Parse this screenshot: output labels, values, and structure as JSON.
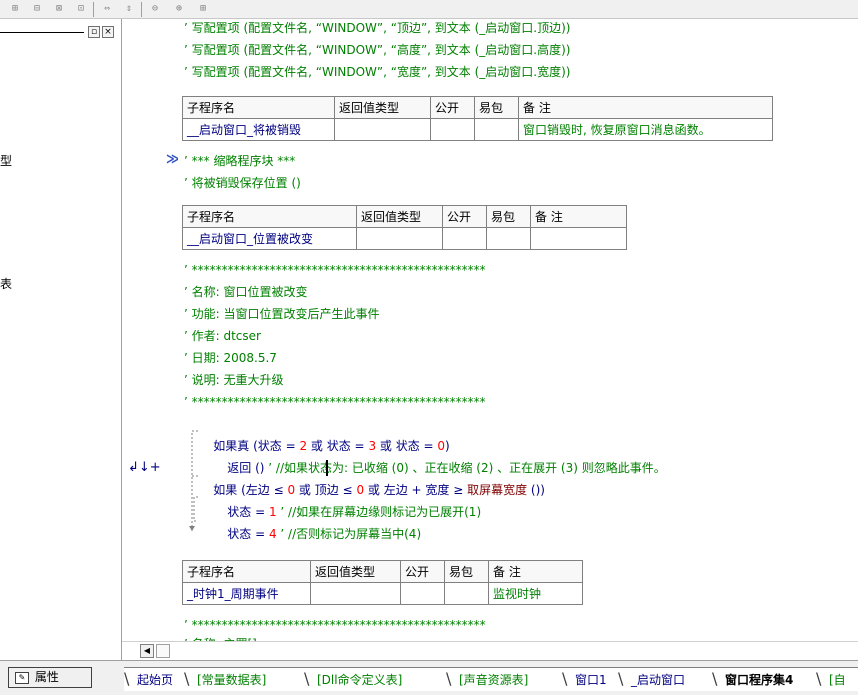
{
  "toolbar": {
    "icons": [
      "grid-icon",
      "align-top-icon",
      "align-middle-icon",
      "align-bottom-icon",
      "width-equal-icon",
      "height-equal-icon",
      "hspace-icon",
      "vspace-icon",
      "center-icon"
    ]
  },
  "left_panel": {
    "title_line": "",
    "frag1": "型",
    "frag2": "表",
    "close_x": "×"
  },
  "gutter": {
    "marker": "≫",
    "arrows": "↲↓+"
  },
  "lines": {
    "l1": "’ 写配置项 (配置文件名, “WINDOW”, “顶边”, 到文本 (_启动窗口.顶边))",
    "l2": "’ 写配置项 (配置文件名, “WINDOW”, “高度”, 到文本 (_启动窗口.高度))",
    "l3": "’ 写配置项 (配置文件名, “WINDOW”, “宽度”, 到文本 (_启动窗口.宽度))",
    "l4": "’ *** 缩略程序块 ***",
    "l5": "’ 将被销毁保存位置 ()",
    "l6": "’ *************************************************",
    "l7": "’ 名称: 窗口位置被改变",
    "l8": "’ 功能: 当窗口位置改变后产生此事件",
    "l9": "’ 作者: dtcser",
    "l10": "’ 日期: 2008.5.7",
    "l11": "’ 说明: 无重大升级",
    "l12": "’ *************************************************",
    "l20": "’ *************************************************",
    "l21": "’ 名称: 主罪[]"
  },
  "code": {
    "if_true": "如果真",
    "state": "状态",
    "cond1": " (状态 = ",
    "n2": "2",
    "or1": " 或 状态 = ",
    "n3": "3",
    "or2": " 或 状态 = ",
    "n0": "0",
    "close": ")",
    "ret": "返回",
    "ret_rest": " () ",
    "ret_cm": "’ //如果状态为: 已收缩 (0) 、正在收缩 (2) 、正在展开 (3) 则忽略此事件。",
    "if": "如果",
    "if_cond_a": " (左边",
    "if_cond_b": " ≤ ",
    "if_n0a": "0",
    "if_cond_c": " 或 顶边 ≤ ",
    "if_n0b": "0",
    "if_cond_d": " 或 左边 + 宽度 ≥ ",
    "if_fn": "取屏幕宽度",
    "if_cond_e": " ())",
    "assign1_a": "状态 = ",
    "assign1_n": "1",
    "assign1_cm": " ’ //如果在屏幕边缘则标记为已展开(1)",
    "assign2_a": "状态 = ",
    "assign2_n": "4",
    "assign2_cm": " ’ //否则标记为屏幕当中(4)"
  },
  "tables": {
    "t1": {
      "headers": [
        "子程序名",
        "返回值类型",
        "公开",
        "易包",
        "备 注"
      ],
      "row": [
        "__启动窗口_将被销毁",
        "",
        "",
        "",
        "窗口销毁时, 恢复原窗口消息函数。"
      ]
    },
    "t2": {
      "headers": [
        "子程序名",
        "返回值类型",
        "公开",
        "易包",
        "备 注"
      ],
      "row": [
        "__启动窗口_位置被改变",
        "",
        "",
        "",
        ""
      ]
    },
    "t3": {
      "headers": [
        "子程序名",
        "返回值类型",
        "公开",
        "易包",
        "备 注"
      ],
      "row": [
        "_时钟1_周期事件",
        "",
        "",
        "",
        "监视时钟"
      ]
    }
  },
  "statusbar": {
    "prop_label": "属性",
    "prop_icon": "properties-icon"
  },
  "tabs": [
    "起始页",
    "[常量数据表]",
    "[Dll命令定义表]",
    "[声音资源表]",
    "窗口1",
    "_启动窗口",
    "窗口程序集4",
    "[自"
  ],
  "colors": {
    "comment": "#008000",
    "keyword": "#000080",
    "number": "#ff0000",
    "function": "#800000"
  }
}
